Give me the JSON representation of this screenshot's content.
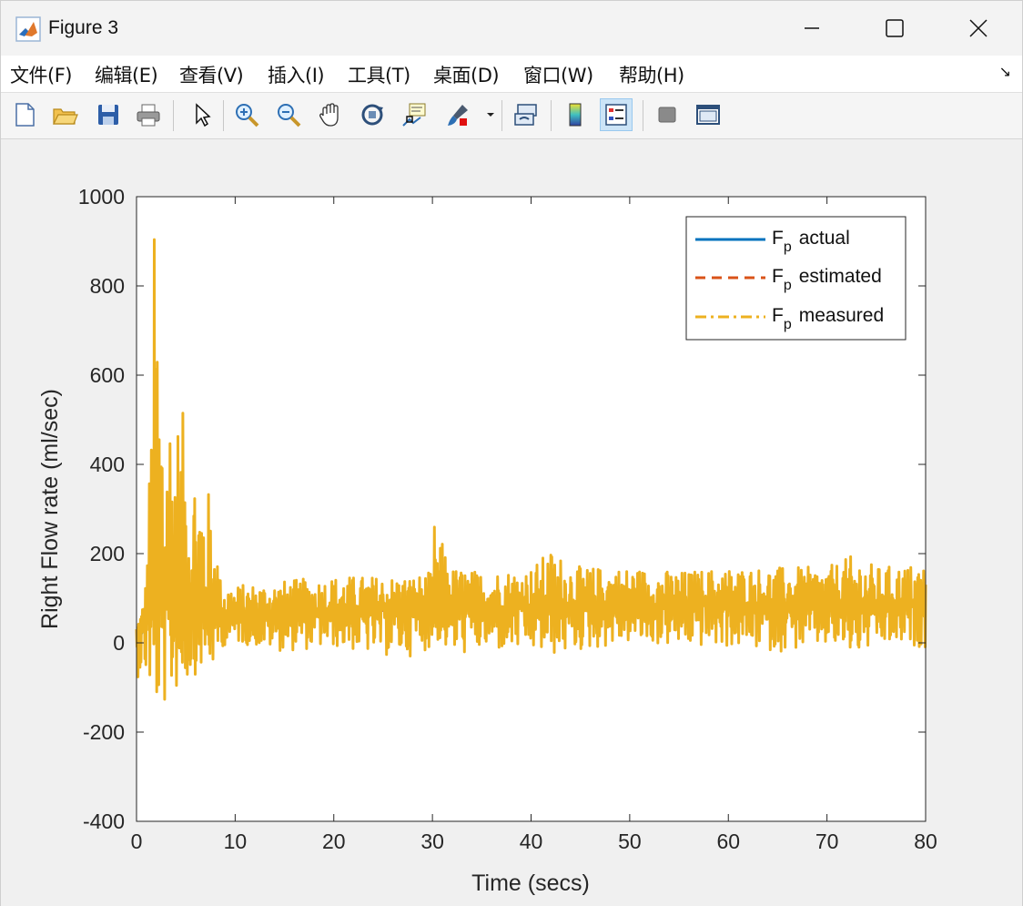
{
  "window": {
    "title": "Figure 3",
    "icon": "matlab-icon",
    "controls": [
      "minimize-icon",
      "maximize-icon",
      "close-icon"
    ]
  },
  "menu": {
    "items": [
      "文件(F)",
      "编辑(E)",
      "查看(V)",
      "插入(I)",
      "工具(T)",
      "桌面(D)",
      "窗口(W)",
      "帮助(H)"
    ],
    "more_icon": "dock-arrow-icon"
  },
  "toolbar": {
    "buttons": [
      "new-figure-icon",
      "open-file-icon",
      "save-icon",
      "print-icon",
      "select-arrow-icon",
      "zoom-in-icon",
      "zoom-out-icon",
      "pan-hand-icon",
      "rotate-3d-icon",
      "data-cursor-icon",
      "brush-icon",
      "link-plot-icon",
      "colorbar-icon",
      "legend-icon",
      "hide-tools-icon",
      "show-tools-icon"
    ],
    "active": "legend-icon"
  },
  "chart_data": {
    "type": "line",
    "xlabel": "Time (secs)",
    "ylabel": "Right Flow rate (ml/sec)",
    "xlim": [
      0,
      80
    ],
    "ylim": [
      -400,
      1000
    ],
    "xticks": [
      "0",
      "10",
      "20",
      "30",
      "40",
      "50",
      "60",
      "70",
      "80"
    ],
    "yticks": [
      "1000",
      "800",
      "600",
      "400",
      "200",
      "0",
      "-200",
      "-400"
    ],
    "grid": false,
    "legend_position": "top-right",
    "legend": [
      {
        "base": "F",
        "sub": "p",
        "label": "actual"
      },
      {
        "base": "F",
        "sub": "p",
        "label": "estimated"
      },
      {
        "base": "F",
        "sub": "p",
        "label": "measured"
      }
    ],
    "series": [
      {
        "name": "Fp actual",
        "style": "solid",
        "color": "#0072BD",
        "envelope": {
          "x": [
            0,
            2,
            5,
            8,
            10,
            20,
            40,
            60,
            80
          ],
          "y": [
            0,
            80,
            75,
            65,
            60,
            70,
            80,
            85,
            85
          ]
        }
      },
      {
        "name": "Fp estimated",
        "style": "dashed",
        "color": "#D95319",
        "envelope": {
          "x": [
            0,
            2,
            5,
            8,
            10,
            20,
            40,
            60,
            80
          ],
          "y": [
            0,
            80,
            75,
            65,
            60,
            70,
            80,
            85,
            85
          ]
        }
      },
      {
        "name": "Fp measured",
        "style": "dash-dot",
        "color": "#EDB120",
        "envelope": {
          "x": [
            0,
            0.5,
            1.0,
            1.5,
            1.8,
            2.0,
            2.5,
            3.0,
            3.5,
            4.0,
            4.5,
            5.0,
            5.5,
            6.0,
            6.5,
            7.0,
            7.5,
            8.0,
            8.5,
            10,
            15,
            20,
            25,
            28,
            30,
            30.2,
            32,
            35,
            40,
            42,
            45,
            50,
            55,
            60,
            65,
            70,
            73,
            75,
            80
          ],
          "max": [
            60,
            70,
            150,
            560,
            940,
            880,
            640,
            560,
            610,
            540,
            510,
            530,
            460,
            430,
            400,
            370,
            330,
            280,
            150,
            130,
            140,
            150,
            150,
            150,
            160,
            270,
            170,
            160,
            170,
            210,
            170,
            170,
            160,
            170,
            170,
            170,
            200,
            170,
            180
          ],
          "min": [
            -80,
            -70,
            -90,
            -120,
            -220,
            -160,
            -140,
            -150,
            -120,
            -110,
            -100,
            -90,
            -80,
            -70,
            -60,
            -60,
            -55,
            -60,
            -10,
            0,
            -20,
            -10,
            -30,
            -30,
            -10,
            10,
            -30,
            -20,
            -20,
            -30,
            -20,
            0,
            -10,
            -10,
            -20,
            -10,
            -30,
            -10,
            -10
          ],
          "center": [
            0,
            40,
            80,
            90,
            100,
            90,
            90,
            85,
            80,
            80,
            75,
            75,
            70,
            70,
            70,
            65,
            65,
            60,
            60,
            60,
            65,
            70,
            75,
            78,
            80,
            80,
            80,
            80,
            80,
            80,
            85,
            85,
            85,
            85,
            85,
            85,
            85,
            85,
            85
          ]
        }
      }
    ]
  },
  "colors": {
    "actual": "#0072BD",
    "estimated": "#D95319",
    "measured": "#EDB120",
    "axes_bg": "#ffffff",
    "figure_bg": "#f0f0f0"
  }
}
